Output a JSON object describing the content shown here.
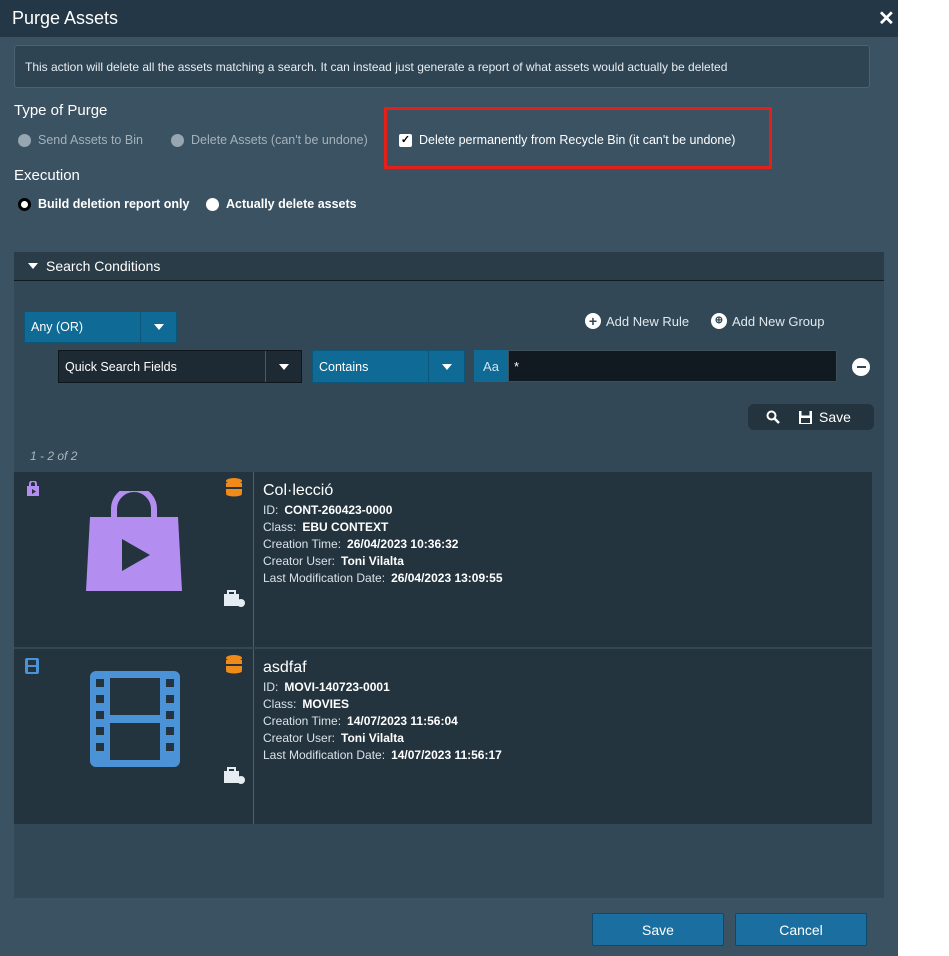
{
  "dialog": {
    "title": "Purge Assets",
    "close_glyph": "✕",
    "info_text": "This action will delete all the assets matching a search. It can instead just generate a report of what assets would actually be deleted"
  },
  "type_of_purge": {
    "label": "Type of Purge",
    "options": [
      {
        "label": "Send Assets to Bin",
        "enabled": false
      },
      {
        "label": "Delete Assets (can't be undone)",
        "enabled": false
      },
      {
        "label": "Delete permanently from Recycle Bin (it can't be undone)",
        "checked": true
      }
    ]
  },
  "execution": {
    "label": "Execution",
    "options": [
      {
        "label": "Build deletion report only",
        "selected": true
      },
      {
        "label": "Actually delete assets",
        "selected": false
      }
    ]
  },
  "search": {
    "header": "Search Conditions",
    "match_mode": "Any (OR)",
    "add_rule": "Add New Rule",
    "add_group": "Add New Group",
    "rule": {
      "field": "Quick Search Fields",
      "operator": "Contains",
      "case_toggle": "Aa",
      "value": "*"
    },
    "save_label": "Save"
  },
  "results": {
    "count_text": "1 - 2 of 2",
    "items": [
      {
        "name": "Col·lecció",
        "id_label": "ID:",
        "id": "CONT-260423-0000",
        "class_label": "Class:",
        "class": "EBU CONTEXT",
        "creation_label": "Creation Time:",
        "creation": "26/04/2023 10:36:32",
        "creator_label": "Creator User:",
        "creator": "Toni Vilalta",
        "modified_label": "Last Modification Date:",
        "modified": "26/04/2023 13:09:55",
        "type_icon": "shopping-bag-play-icon",
        "type_color": "#b38df0"
      },
      {
        "name": "asdfaf",
        "id_label": "ID:",
        "id": "MOVI-140723-0001",
        "class_label": "Class:",
        "class": "MOVIES",
        "creation_label": "Creation Time:",
        "creation": "14/07/2023 11:56:04",
        "creator_label": "Creator User:",
        "creator": "Toni Vilalta",
        "modified_label": "Last Modification Date:",
        "modified": "14/07/2023 11:56:17",
        "type_icon": "film-strip-icon",
        "type_color": "#4b93d6"
      }
    ]
  },
  "footer": {
    "save_label": "Save",
    "cancel_label": "Cancel"
  },
  "colors": {
    "highlight": "#e32019",
    "storage_icon": "#f08a18",
    "accent_blue": "#0f6a96"
  }
}
